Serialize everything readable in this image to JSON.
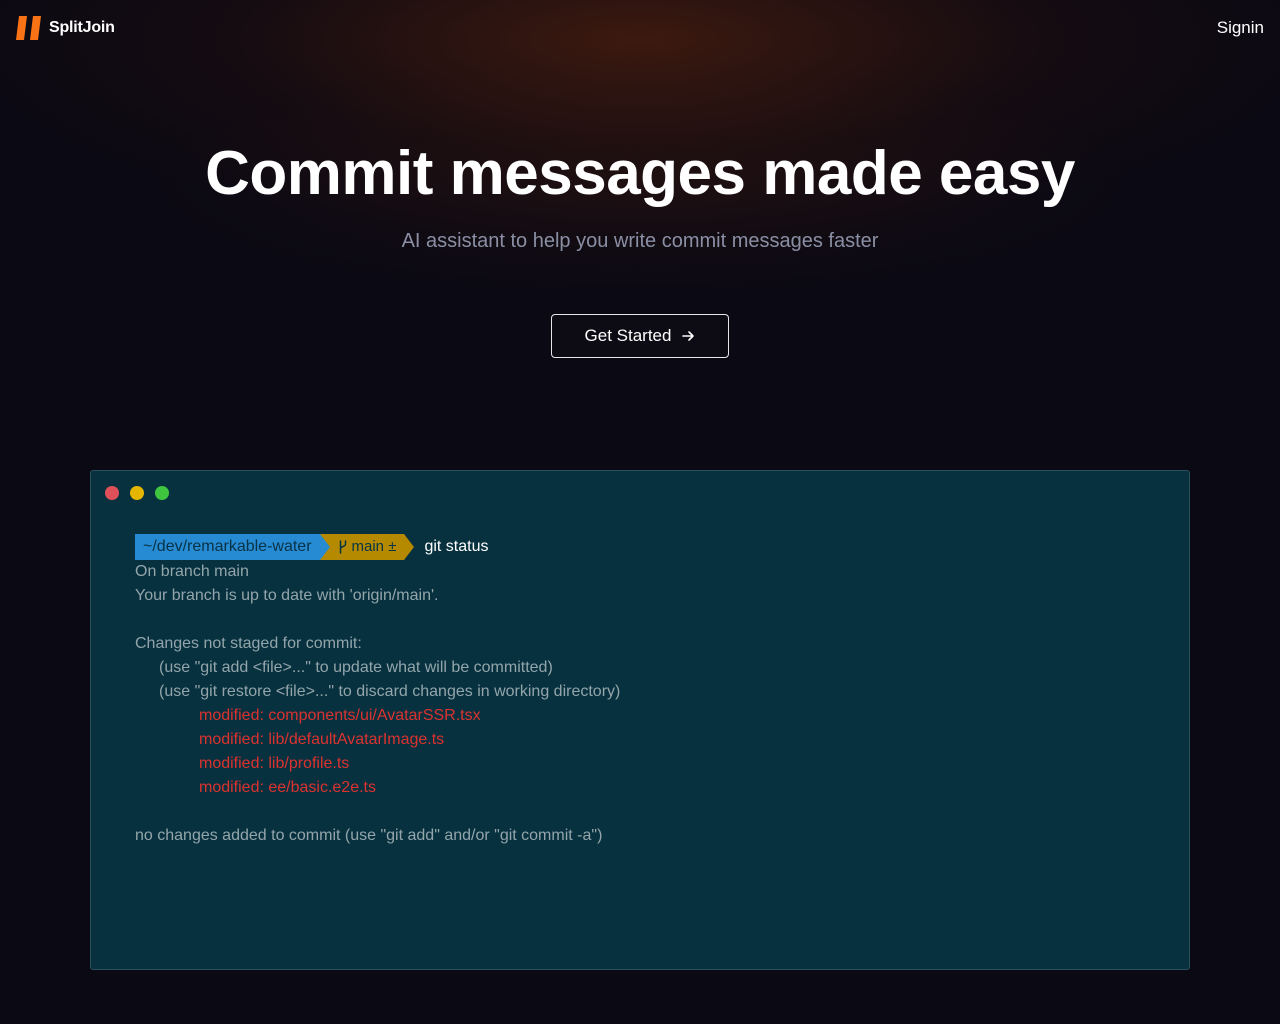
{
  "nav": {
    "brand": "SplitJoin",
    "signin": "Signin"
  },
  "hero": {
    "title": "Commit messages made easy",
    "subtitle": "AI assistant to help you write commit messages faster",
    "cta_label": "Get Started"
  },
  "colors": {
    "logo_orange": "#f97316",
    "terminal_bg": "#07313f",
    "path_segment": "#268bd2",
    "branch_segment": "#b58900",
    "modified_text": "#dc322f",
    "dot_red": "#e0505a",
    "dot_yellow": "#e5b600",
    "dot_green": "#3ec43e"
  },
  "terminal": {
    "prompt": {
      "path": "~/dev/remarkable-water",
      "branch": "main ±",
      "command": "git status"
    },
    "output": {
      "on_branch": "On branch main",
      "up_to_date": "Your branch is up to date with 'origin/main'.",
      "changes_header": "Changes not staged for commit:",
      "hint_add": "(use \"git add <file>...\" to update what will be committed)",
      "hint_restore": "(use \"git restore <file>...\" to discard changes in working directory)",
      "modified": [
        "modified: components/ui/AvatarSSR.tsx",
        "modified: lib/defaultAvatarImage.ts",
        "modified: lib/profile.ts",
        "modified: ee/basic.e2e.ts"
      ],
      "footer": "no changes added to commit (use \"git add\" and/or \"git commit -a\")"
    }
  }
}
